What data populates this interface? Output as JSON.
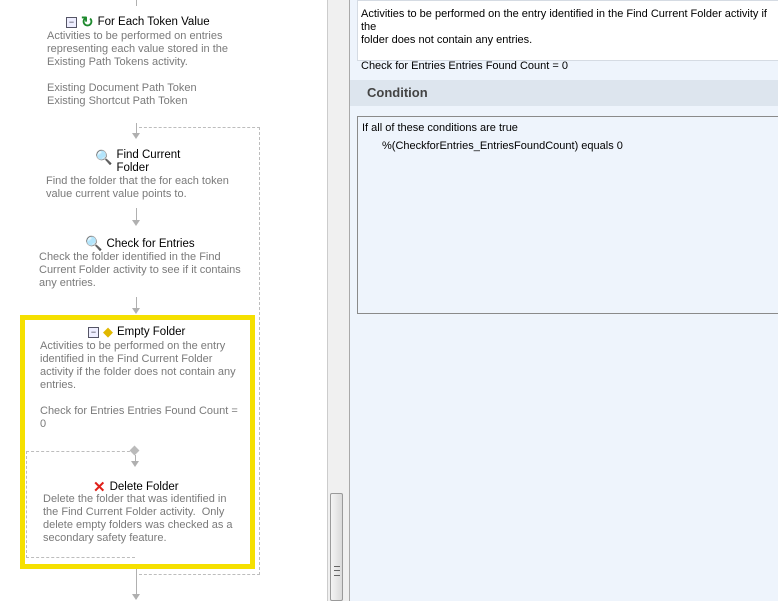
{
  "workflow": {
    "for_each": {
      "title": "For Each Token Value",
      "desc": "Activities to be performed on entries\nrepresenting each value stored in the\nExisting Path Tokens activity.\n\nExisting Document Path Token\nExisting Shortcut Path Token"
    },
    "find_folder": {
      "title": "Find Current\nFolder",
      "desc": "Find the folder that the for each token\nvalue current value points to."
    },
    "check_entries": {
      "title": "Check for Entries",
      "desc": "Check the folder identified in the Find\nCurrent Folder activity to see if it contains\nany entries."
    },
    "empty_folder": {
      "title": "Empty Folder",
      "desc": "Activities to be performed on the entry\nidentified in the Find Current Folder\nactivity if the folder does not contain any\nentries.\n\nCheck for Entries Entries Found Count =\n0"
    },
    "delete_folder": {
      "title": "Delete Folder",
      "desc": "Delete the folder that was identified in\nthe Find Current Folder activity.  Only\ndelete empty folders was checked as a\nsecondary safety feature."
    }
  },
  "properties": {
    "description": "Activities to be performed on the entry identified in the Find Current Folder activity if the\nfolder does not contain any entries.\n\nCheck for Entries Entries Found Count = 0",
    "condition_header": "Condition",
    "condition_line1": "If all of these conditions are true",
    "condition_line2": "%(CheckforEntries_EntriesFoundCount) equals 0"
  },
  "colors": {
    "highlight": "#f5e000",
    "pane": "#eef4fc"
  }
}
